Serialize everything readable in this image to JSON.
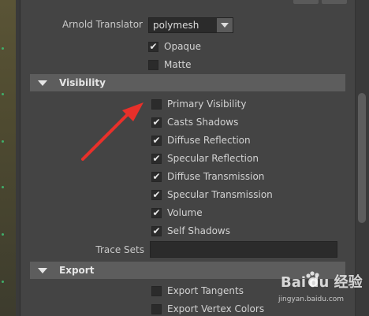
{
  "arnold": {
    "translator_label": "Arnold Translator",
    "translator_value": "polymesh"
  },
  "top_checkboxes": [
    {
      "label": "Opaque",
      "checked": true
    },
    {
      "label": "Matte",
      "checked": false
    }
  ],
  "visibility": {
    "title": "Visibility",
    "items": [
      {
        "label": "Primary Visibility",
        "checked": false
      },
      {
        "label": "Casts Shadows",
        "checked": true
      },
      {
        "label": "Diffuse Reflection",
        "checked": true
      },
      {
        "label": "Specular Reflection",
        "checked": true
      },
      {
        "label": "Diffuse Transmission",
        "checked": true
      },
      {
        "label": "Specular Transmission",
        "checked": true
      },
      {
        "label": "Volume",
        "checked": true
      },
      {
        "label": "Self Shadows",
        "checked": true
      }
    ],
    "trace_sets_label": "Trace Sets",
    "trace_sets_value": ""
  },
  "export": {
    "title": "Export",
    "items": [
      {
        "label": "Export Tangents",
        "checked": false
      },
      {
        "label": "Export Vertex Colors",
        "checked": false
      }
    ]
  },
  "watermark": {
    "main": "Bai du 经验",
    "sub": "jingyan.baidu.com"
  },
  "colors": {
    "panel_bg": "#444444",
    "section_bg": "#5d5d5d",
    "field_bg": "#2b2b2b",
    "annotation_arrow": "#e8302a"
  }
}
